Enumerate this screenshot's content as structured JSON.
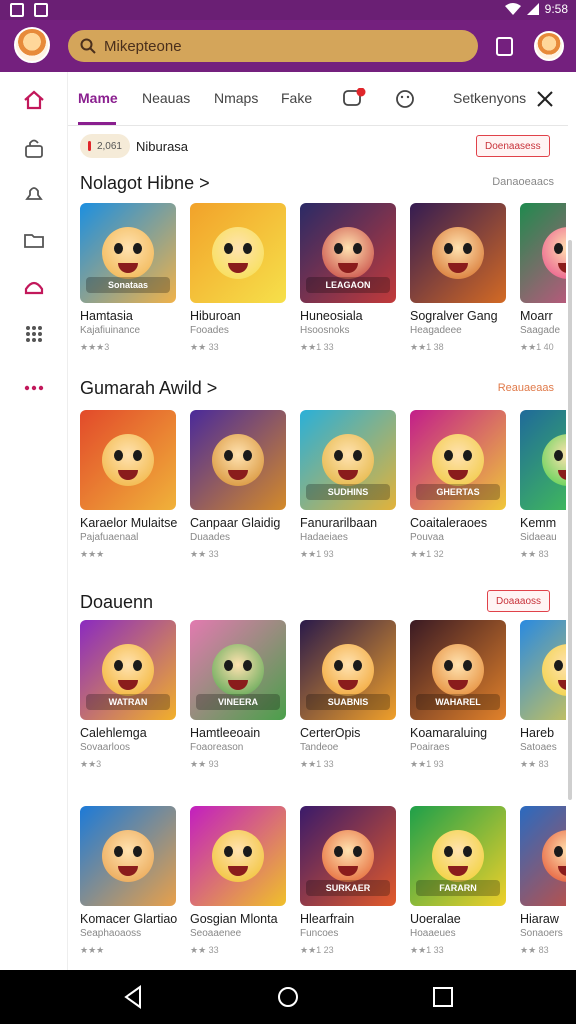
{
  "status_bar": {
    "time": "9:58"
  },
  "top_bar": {
    "search_value": "Mikepteone",
    "search_placeholder": "Search"
  },
  "sidebar": {
    "items": [
      "home-icon",
      "lock-icon",
      "bell-icon",
      "folder-icon",
      "alarm-icon",
      "grid-icon",
      "more-icon"
    ]
  },
  "tabs": [
    {
      "label": "Mame"
    },
    {
      "label": "Neauas"
    },
    {
      "label": "Nmaps"
    },
    {
      "label": "Fake"
    },
    {
      "label": "Setkenyons"
    }
  ],
  "chip": {
    "count": "2,061",
    "label": "Niburasa",
    "button": "Doenaasess"
  },
  "sections": [
    {
      "title": "Nolagot Hibne >",
      "link": "Danaoeaacs",
      "cards": [
        {
          "title": "Hamtasia",
          "sub": "Kajafiuinance",
          "rating": "★★★3",
          "banner": "Sonataas",
          "colors": [
            "#1c8fe0",
            "#f0b24a"
          ]
        },
        {
          "title": "Hiburoan",
          "sub": "Fooades",
          "rating": "★★ 33",
          "banner": "",
          "colors": [
            "#f2a22a",
            "#f6e04a"
          ]
        },
        {
          "title": "Huneosiala",
          "sub": "Hsoosnoks",
          "rating": "★★1 33",
          "banner": "LEAGAON",
          "colors": [
            "#2a2a66",
            "#c23a3a"
          ]
        },
        {
          "title": "Sogralver Gang",
          "sub": "Heagadeee",
          "rating": "★★1 38",
          "banner": "",
          "colors": [
            "#341c52",
            "#d36a24"
          ]
        },
        {
          "title": "Moarr",
          "sub": "Saagade",
          "rating": "★★1 40",
          "banner": "",
          "colors": [
            "#1f8a4e",
            "#e84a8a"
          ]
        }
      ]
    },
    {
      "title": "Gumarah Awild >",
      "link": "Reauaeaas",
      "cards": [
        {
          "title": "Karaelor Mulaitse",
          "sub": "Pajafuaenaal",
          "rating": "★★★",
          "banner": "",
          "colors": [
            "#e24a2a",
            "#f0b23a"
          ]
        },
        {
          "title": "Canpaar Glaidig",
          "sub": "Duaades",
          "rating": "★★ 33",
          "banner": "",
          "colors": [
            "#4a2a9a",
            "#d38a2a"
          ]
        },
        {
          "title": "Fanurarilbaan",
          "sub": "Hadaeiaes",
          "rating": "★★1 93",
          "banner": "SUDHINS",
          "colors": [
            "#2ab0d8",
            "#e2b23a"
          ]
        },
        {
          "title": "Coaitaleraoes",
          "sub": "Pouvaa",
          "rating": "★★1 32",
          "banner": "GHERTAS",
          "colors": [
            "#c21e8a",
            "#f0c83a"
          ]
        },
        {
          "title": "Kemm",
          "sub": "Sidaeau",
          "rating": "★★ 83",
          "banner": "",
          "colors": [
            "#1f6a9a",
            "#4ad04a"
          ]
        }
      ]
    },
    {
      "title": "Doauenn",
      "link": "Doaaaoss",
      "cards": [
        {
          "title": "Calehlemga",
          "sub": "Sovaarloos",
          "rating": "★★3",
          "banner": "WATRAN",
          "colors": [
            "#8a2ac0",
            "#f2b02a"
          ]
        },
        {
          "title": "Hamtleeoain",
          "sub": "Foaoreason",
          "rating": "★★ 93",
          "banner": "VINEERA",
          "colors": [
            "#e27ab0",
            "#4aa04a"
          ]
        },
        {
          "title": "CerterOpis",
          "sub": "Tandeoe",
          "rating": "★★1 33",
          "banner": "SUABNIS",
          "colors": [
            "#2a1a4a",
            "#f0a02a"
          ]
        },
        {
          "title": "Koamaraluing",
          "sub": "Poairaes",
          "rating": "★★1 93",
          "banner": "WAHAREL",
          "colors": [
            "#3a1a24",
            "#e2822a"
          ]
        },
        {
          "title": "Hareb",
          "sub": "Satoaes",
          "rating": "★★ 83",
          "banner": "",
          "colors": [
            "#2a8ae0",
            "#f0d03a"
          ]
        }
      ]
    },
    {
      "title": "",
      "link": "",
      "cards": [
        {
          "title": "Komacer Glartiao",
          "sub": "Seaphaoaoss",
          "rating": "★★★",
          "banner": "",
          "colors": [
            "#1c7ad8",
            "#e8a04a"
          ]
        },
        {
          "title": "Gosgian Mlonta",
          "sub": "Seoaaenee",
          "rating": "★★ 33",
          "banner": "",
          "colors": [
            "#c21ec0",
            "#f0c02a"
          ]
        },
        {
          "title": "Hlearfrain",
          "sub": "Funcoes",
          "rating": "★★1 23",
          "banner": "SURKAER",
          "colors": [
            "#3a1a6a",
            "#e25a2a"
          ]
        },
        {
          "title": "Uoeralae",
          "sub": "Hoaaeues",
          "rating": "★★1 33",
          "banner": "FARARN",
          "colors": [
            "#1ea04a",
            "#f0d02a"
          ]
        },
        {
          "title": "Hiaraw",
          "sub": "Sonaoers",
          "rating": "★★ 83",
          "banner": "",
          "colors": [
            "#2a6ac0",
            "#e24a2a"
          ]
        }
      ]
    }
  ]
}
